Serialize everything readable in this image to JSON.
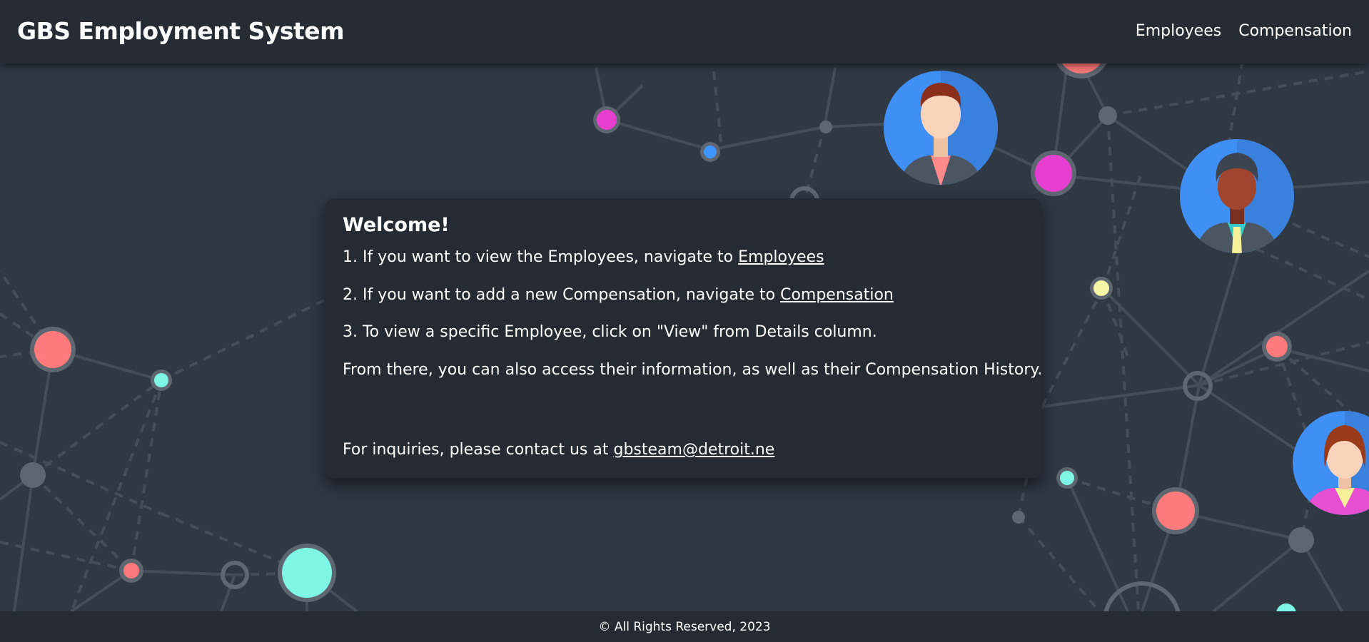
{
  "header": {
    "brand": "GBS Employment System",
    "nav": {
      "employees": "Employees",
      "compensation": "Compensation"
    }
  },
  "welcome": {
    "title": "Welcome!",
    "line1_prefix": "1. If you want to view the Employees, navigate to ",
    "line1_link": "Employees",
    "line2_prefix": "2. If you want to add a new Compensation, navigate to ",
    "line2_link": "Compensation",
    "line3": "3. To view a specific Employee, click on \"View\" from Details column.",
    "line4": "From there, you can also access their information, as well as their Compensation History.",
    "contact_prefix": "For inquiries, please contact us at ",
    "contact_email": "gbsteam@detroit.ne"
  },
  "footer": {
    "text": "© All Rights Reserved, 2023"
  },
  "colors": {
    "background": "#2f3843",
    "navbar": "#262c33",
    "card": "#252b33",
    "node_pink": "#e63fcf",
    "node_coral": "#ff7a7a",
    "node_cyan": "#7ff5e6",
    "node_blue": "#3f95ff",
    "node_yellow": "#f7f7a8",
    "node_gray": "#5e6670"
  }
}
